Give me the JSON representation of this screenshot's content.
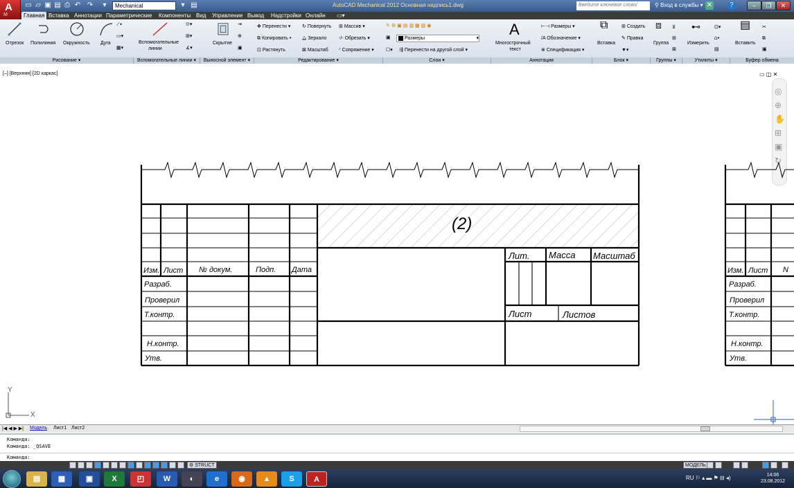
{
  "titlebar": {
    "app_button_label": "A",
    "app_button_sub": "M",
    "workspace": "Mechanical",
    "title": "AutoCAD Mechanical 2012   Основная надпись1.dwg",
    "search_placeholder": "Введите ключевое слово/фразу",
    "login": "Вход в службы",
    "minimize": "–",
    "restore": "❐",
    "close": "✕"
  },
  "tabs": [
    "Главная",
    "Вставка",
    "Аннотации",
    "Параметрические",
    "Компоненты",
    "Вид",
    "Управление",
    "Вывод",
    "Надстройки",
    "Онлайн"
  ],
  "ribbon": {
    "draw": {
      "line": "Отрезок",
      "polyline": "Полилиния",
      "circle": "Окружность",
      "arc": "Дуга",
      "label": "Рисование ▾"
    },
    "construction": {
      "lines": "Вспомогательные",
      "lines2": "линии",
      "label": "Вспомогательные линии ▾"
    },
    "hidden": {
      "hide": "Скрытие",
      "label": "Выносной элемент ▾"
    },
    "modify": {
      "move": "Перенести ▾",
      "rotate": "Повернуть",
      "array": "Массив ▾",
      "copy": "Копировать ▾",
      "mirror": "Зеркало",
      "trim": "Обрезать ▾",
      "stretch": "Растянуть",
      "scale": "Масштаб",
      "fillet": "Сопряжение ▾",
      "label": "Редактирование ▾"
    },
    "layers": {
      "current": "Размеры",
      "move_to": "Перенести на другой слой ▾",
      "label": "Слои ▾"
    },
    "annotation": {
      "mtext": "Многострочный",
      "mtext2": "текст",
      "dims": "Размеры ▾",
      "symbol": "Обозначение ▾",
      "spec": "Спецификация ▾",
      "label": "Аннотация"
    },
    "block": {
      "insert": "Вставка",
      "create": "Создать",
      "edit": "Правка",
      "label": "Блок ▾"
    },
    "groups": {
      "group": "Группа",
      "label": "Группы ▾"
    },
    "utilities": {
      "measure": "Измерить",
      "label": "Утилиты ▾"
    },
    "clipboard": {
      "paste": "Вставить",
      "label": "Буфер обмена"
    }
  },
  "viewport": {
    "label": "[–] [Верхняя] [2D каркас]"
  },
  "drawing": {
    "hatch_label": "(2)",
    "izm": "Изм.",
    "list": "Лист",
    "ndoc": "№ докум.",
    "podp": "Подп.",
    "data": "Дата",
    "razrab": "Разраб.",
    "proveril": "Проверил",
    "tkontr": "Т.контр.",
    "nkontr": "Н.контр.",
    "utv": "Утв.",
    "lit": "Лит.",
    "massa": "Масса",
    "masshtab": "Масштаб",
    "list2": "Лист",
    "listov": "Листов",
    "r_izm": "Изм.",
    "r_list": "Лист",
    "r_n": "N",
    "r_razrab": "Разраб.",
    "r_proveril": "Проверил",
    "r_tkontr": "Т.контр.",
    "r_nkontr": "Н.контр.",
    "r_utv": "Утв.",
    "axis_y": "Y",
    "axis_x": "X"
  },
  "layout_tabs": {
    "nav": "|◀ ◀ ▶ ▶|",
    "model": "Модель",
    "sheet1": "Лист1",
    "sheet2": "Лист2"
  },
  "command": {
    "l1": "Команда:",
    "l2": "Команда: _QSAVE",
    "prompt": "Команда:"
  },
  "status": {
    "struct": "STRUCT",
    "model": "МОДЕЛЬ"
  },
  "taskbar": {
    "lang": "RU",
    "time": "14:06",
    "date": "23.08.2012"
  }
}
